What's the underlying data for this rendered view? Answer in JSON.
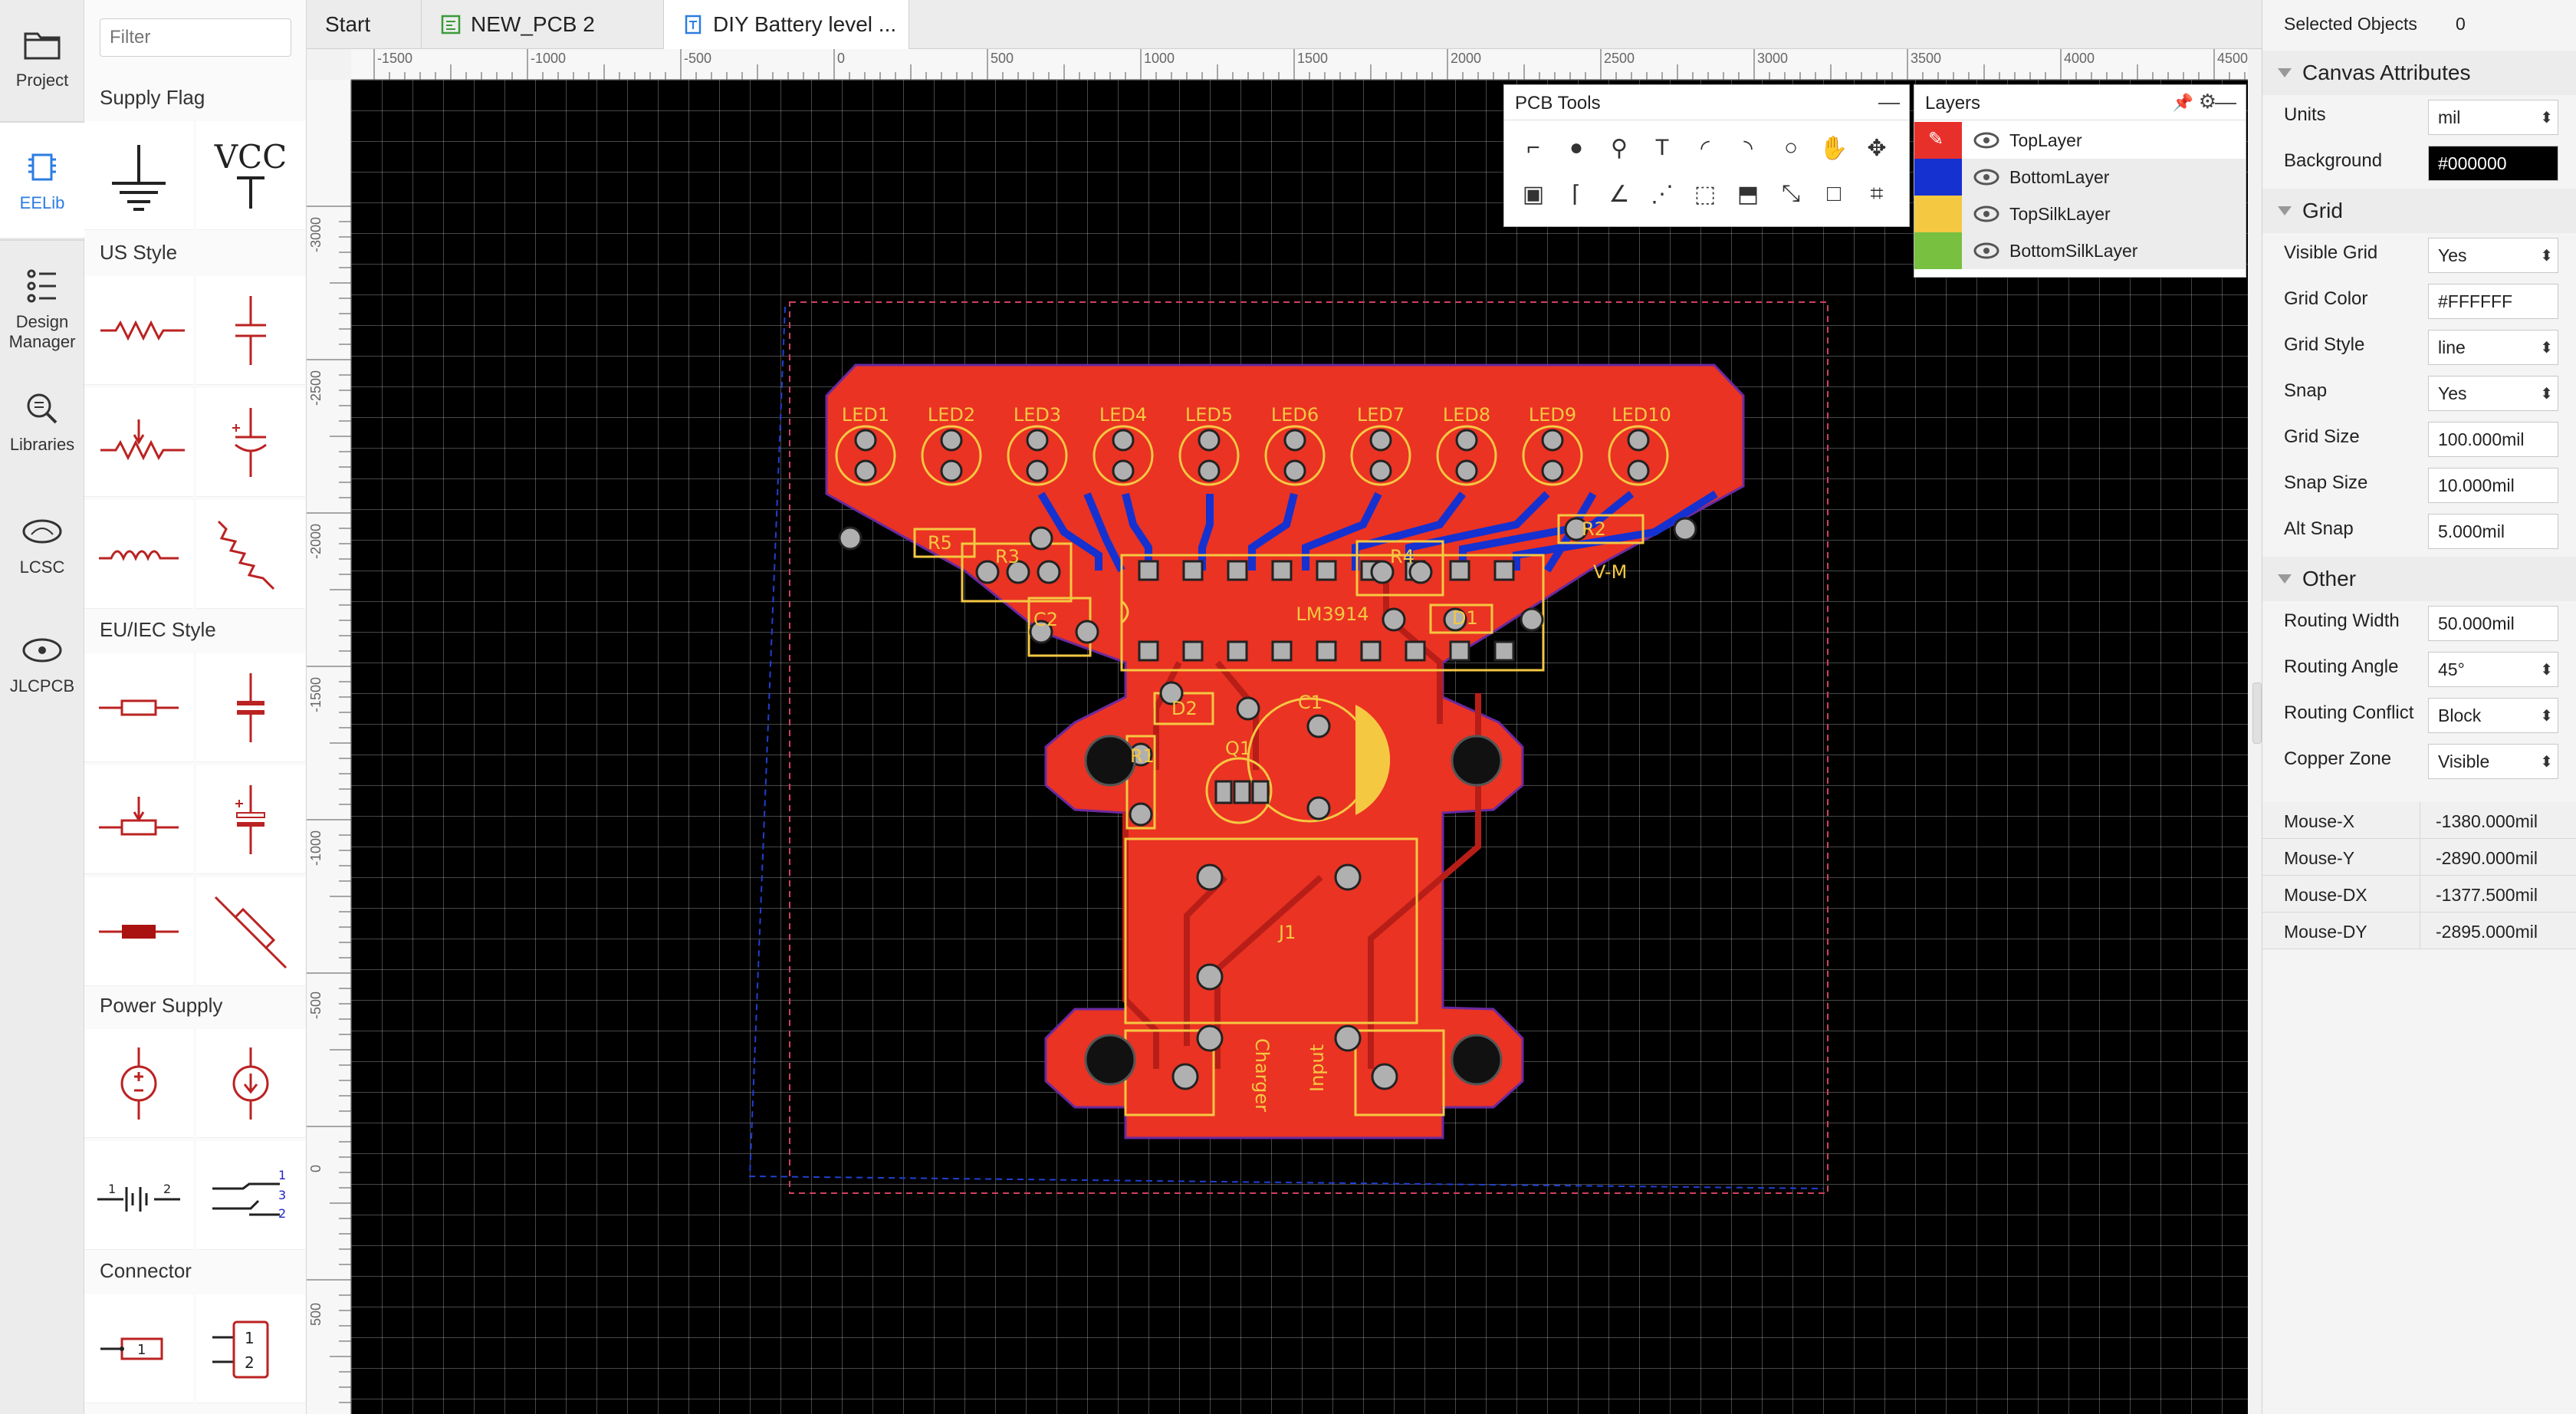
{
  "nav": [
    {
      "label": "Project",
      "icon": "folder-icon"
    },
    {
      "label": "EELib",
      "icon": "chip-icon"
    },
    {
      "label": "Design\nManager",
      "icon": "design-manager-icon"
    },
    {
      "label": "Libraries",
      "icon": "libraries-search-icon"
    },
    {
      "label": "LCSC",
      "icon": "lcsc-logo"
    },
    {
      "label": "JLCPCB",
      "icon": "jlcpcb-logo"
    }
  ],
  "library": {
    "filter_placeholder": "Filter",
    "sections": [
      "Supply Flag",
      "US Style",
      "EU/IEC Style",
      "Power Supply",
      "Connector"
    ],
    "vcc_label": "VCC"
  },
  "tabs": [
    "Start",
    "NEW_PCB 2",
    "DIY Battery level ..."
  ],
  "ruler": {
    "top": [
      "-1500",
      "-1000",
      "-500",
      "0",
      "500",
      "1000",
      "1500",
      "2000",
      "2500",
      "3000",
      "3500",
      "4000",
      "4500"
    ],
    "left": [
      "-3000",
      "-2500",
      "-2000",
      "-1500",
      "-1000",
      "-500",
      "0",
      "500"
    ]
  },
  "pcb_tools": {
    "title": "PCB Tools",
    "tools": [
      "track-tool-icon",
      "pad-tool-icon",
      "via-tool-icon",
      "text-tool-icon",
      "arc-tool-icon",
      "center-arc-tool-icon",
      "circle-tool-icon",
      "pan-hand-icon",
      "canvas-origin-icon",
      "image-tool-icon",
      "dimension-tool-icon",
      "angle-tool-icon",
      "connect-tool-icon",
      "rect-select-icon",
      "solid-region-icon",
      "measure-tool-icon",
      "rect-tool-icon",
      "group-tool-icon"
    ]
  },
  "layers": {
    "title": "Layers",
    "items": [
      {
        "name": "TopLayer",
        "color": "#e8302a"
      },
      {
        "name": "BottomLayer",
        "color": "#1531d0"
      },
      {
        "name": "TopSilkLayer",
        "color": "#f5c842"
      },
      {
        "name": "BottomSilkLayer",
        "color": "#78c040"
      }
    ]
  },
  "board": {
    "labels": [
      "LED1",
      "LED2",
      "LED3",
      "LED4",
      "LED5",
      "LED6",
      "LED7",
      "LED8",
      "LED9",
      "LED10"
    ],
    "parts": [
      "R5",
      "R3",
      "C2",
      "LM3914",
      "R4",
      "R2",
      "V-M",
      "D1",
      "D2",
      "Q1",
      "R1",
      "C1",
      "J1",
      "Charger",
      "Input"
    ]
  },
  "right": {
    "selected_label": "Selected Objects",
    "selected_count": "0",
    "canvas_head": "Canvas Attributes",
    "units_label": "Units",
    "units": "mil",
    "bg_label": "Background",
    "bg": "#000000",
    "grid_head": "Grid",
    "visible_grid_label": "Visible Grid",
    "visible_grid": "Yes",
    "grid_color_label": "Grid Color",
    "grid_color": "#FFFFFF",
    "grid_style_label": "Grid Style",
    "grid_style": "line",
    "snap_label": "Snap",
    "snap": "Yes",
    "grid_size_label": "Grid Size",
    "grid_size": "100.000mil",
    "snap_size_label": "Snap Size",
    "snap_size": "10.000mil",
    "alt_snap_label": "Alt Snap",
    "alt_snap": "5.000mil",
    "other_head": "Other",
    "routing_width_label": "Routing Width",
    "routing_width": "50.000mil",
    "routing_angle_label": "Routing Angle",
    "routing_angle": "45°",
    "routing_conflict_label": "Routing Conflict",
    "routing_conflict": "Block",
    "copper_zone_label": "Copper Zone",
    "copper_zone": "Visible",
    "mouse": [
      {
        "label": "Mouse-X",
        "value": "-1380.000mil"
      },
      {
        "label": "Mouse-Y",
        "value": "-2890.000mil"
      },
      {
        "label": "Mouse-DX",
        "value": "-1377.500mil"
      },
      {
        "label": "Mouse-DY",
        "value": "-2895.000mil"
      }
    ]
  }
}
